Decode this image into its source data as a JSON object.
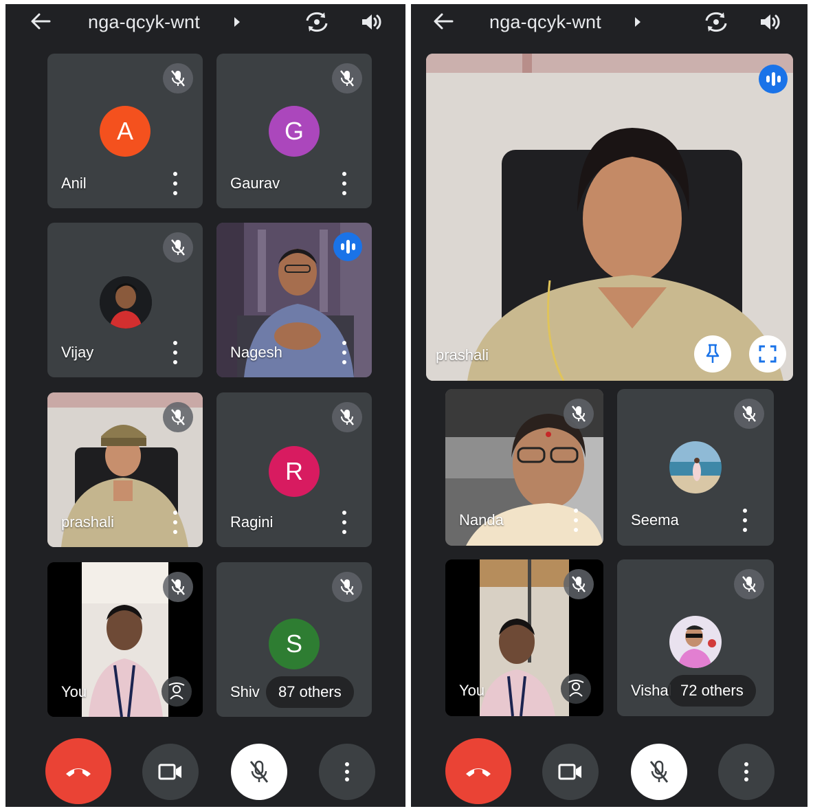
{
  "meeting": {
    "code": "nga-qcyk-wnt"
  },
  "colors": {
    "background": "#202124",
    "tile": "#3c4043",
    "speaking": "#1a73e8",
    "end_call": "#ea4335",
    "avatar_anil": "#f4511e",
    "avatar_gaurav": "#ab47bc",
    "avatar_ragini": "#d81b60",
    "avatar_shiv": "#2e7d32"
  },
  "left_screen": {
    "tiles": [
      {
        "name": "Anil",
        "avatar_letter": "A",
        "status": "muted"
      },
      {
        "name": "Gaurav",
        "avatar_letter": "G",
        "status": "muted"
      },
      {
        "name": "Vijay",
        "avatar": "photo",
        "status": "muted"
      },
      {
        "name": "Nagesh",
        "video": true,
        "status": "speaking"
      },
      {
        "name": "prashali",
        "video": true,
        "status": "muted"
      },
      {
        "name": "Ragini",
        "avatar_letter": "R",
        "status": "muted"
      },
      {
        "name": "You",
        "video": true,
        "status": "muted"
      },
      {
        "name": "Shiv",
        "avatar_letter": "S",
        "status": "muted",
        "others": "87 others"
      }
    ]
  },
  "right_screen": {
    "featured": {
      "name": "prashali",
      "status": "speaking"
    },
    "tiles": [
      {
        "name": "Nanda",
        "video": true,
        "status": "muted"
      },
      {
        "name": "Seema",
        "avatar": "photo",
        "status": "muted"
      },
      {
        "name": "You",
        "video": true,
        "status": "muted"
      },
      {
        "name": "Vishal",
        "avatar": "photo",
        "status": "muted",
        "others": "72 others"
      }
    ]
  },
  "icons": {
    "back": "arrow-back-icon",
    "flip_camera": "flip-camera-icon",
    "speaker": "speaker-icon",
    "muted": "mic-off-icon",
    "speaking": "audio-level-icon",
    "more": "more-vert-icon",
    "self_view": "self-view-icon",
    "pin": "pin-icon",
    "fullscreen": "fullscreen-icon",
    "end_call": "call-end-icon",
    "camera": "videocam-icon",
    "mic": "mic-off-icon"
  }
}
